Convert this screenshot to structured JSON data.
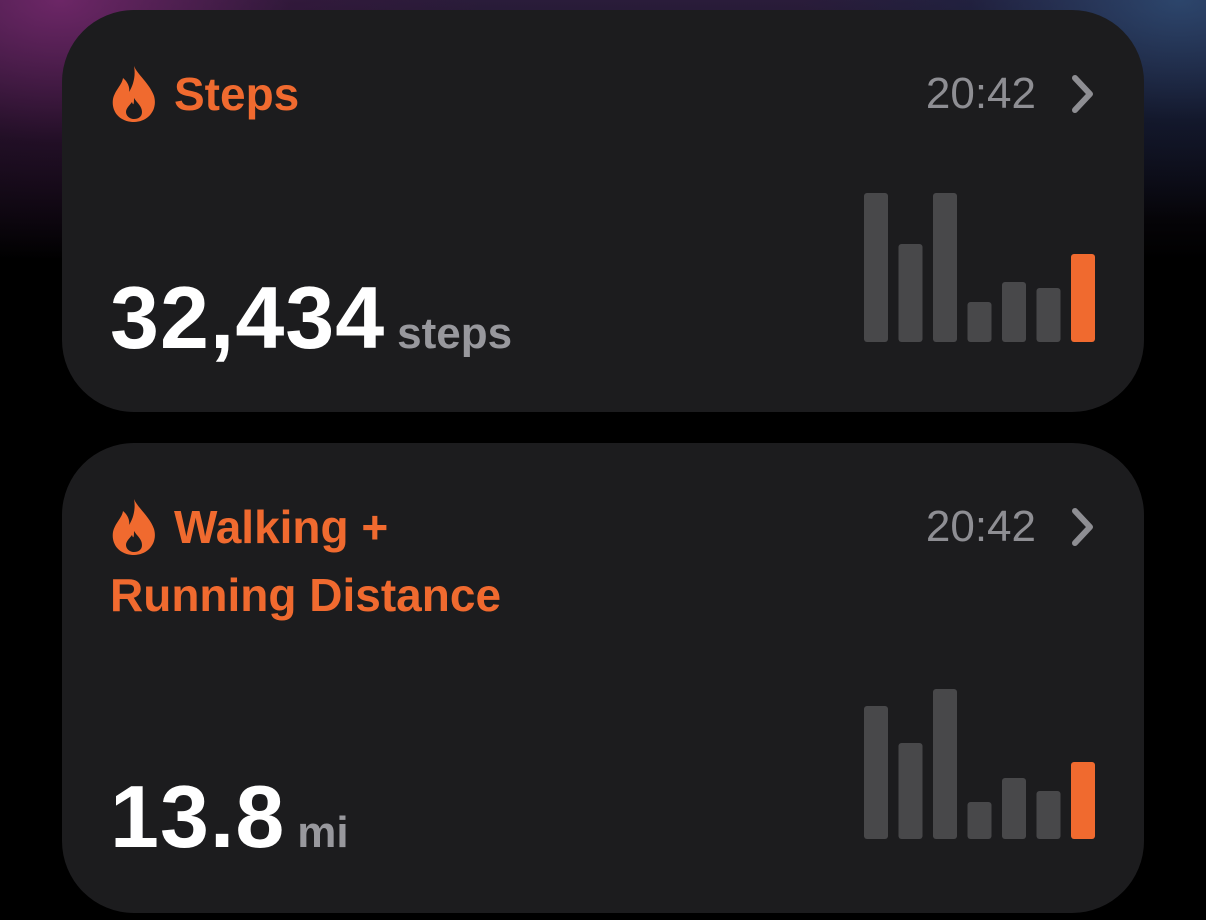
{
  "cards": [
    {
      "title": "Steps",
      "title_line2": "",
      "time": "20:42",
      "value": "32,434",
      "unit": "steps",
      "icon": "flame-icon",
      "chart_data": {
        "type": "bar",
        "values": [
          149,
          98,
          149,
          40,
          60,
          54,
          88
        ],
        "highlight_index": 6
      }
    },
    {
      "title": "Walking +",
      "title_line2": "Running Distance",
      "time": "20:42",
      "value": "13.8",
      "unit": "mi",
      "icon": "flame-icon",
      "chart_data": {
        "type": "bar",
        "values": [
          133,
          96,
          150,
          37,
          61,
          48,
          77
        ],
        "highlight_index": 6
      }
    }
  ],
  "colors": {
    "accent": "#f06a2f",
    "bar": "#48484a",
    "card": "#1c1c1e",
    "secondary_text": "#8e8e93"
  }
}
